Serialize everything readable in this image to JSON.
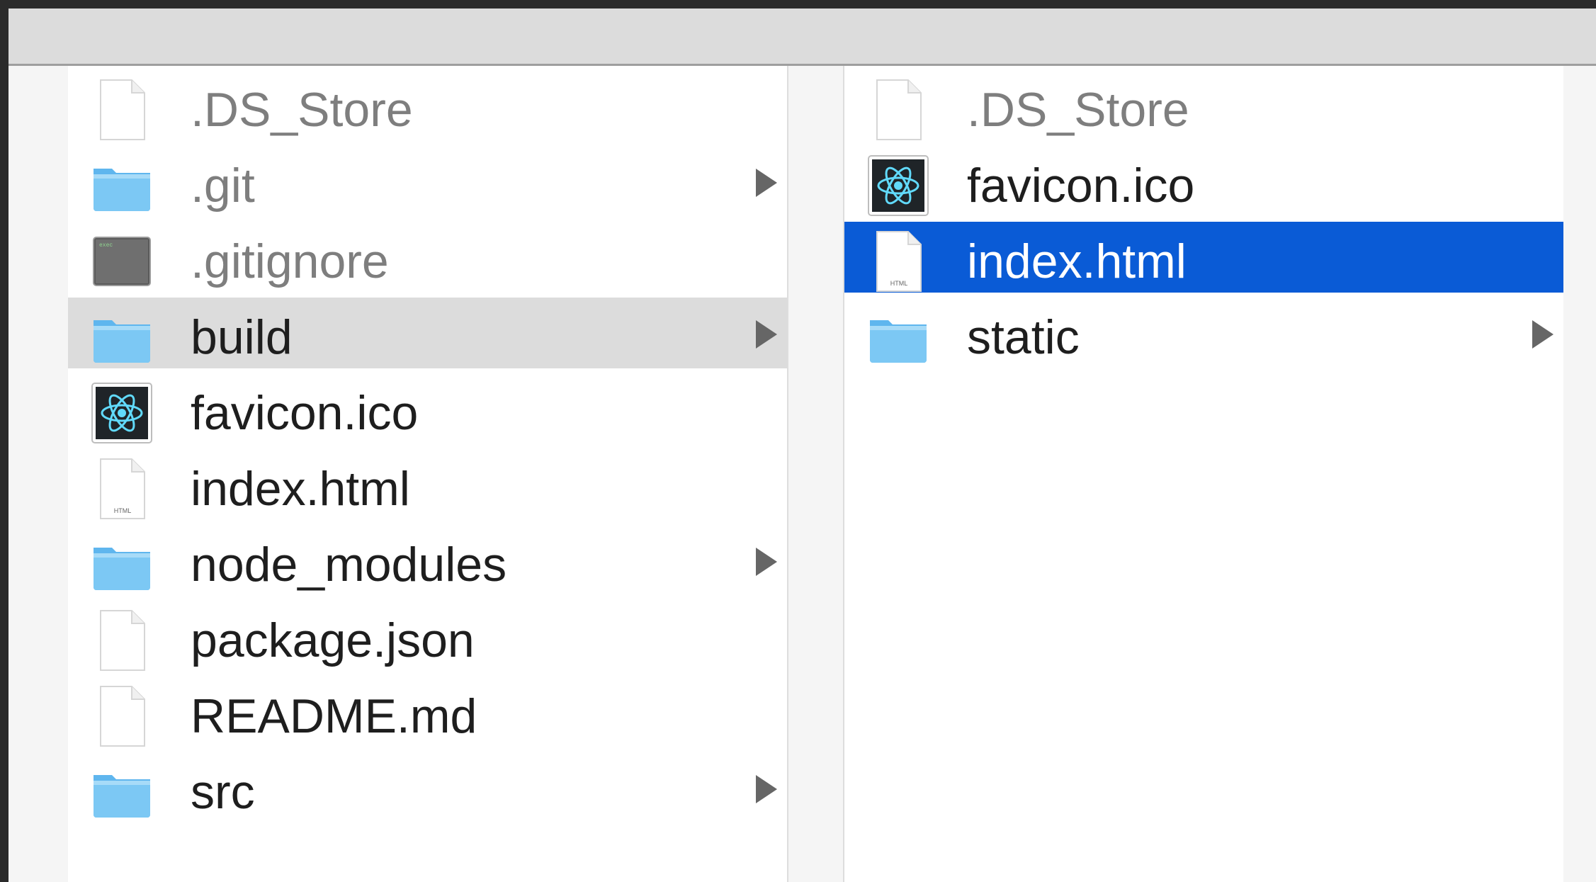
{
  "columns": [
    {
      "items": [
        {
          "name": ".DS_Store",
          "type": "file",
          "icon": "blank-file-icon",
          "dim": true
        },
        {
          "name": ".git",
          "type": "folder",
          "icon": "folder-icon",
          "dim": true
        },
        {
          "name": ".gitignore",
          "type": "file",
          "icon": "terminal-exec-icon",
          "dim": true,
          "icon_text": "exec"
        },
        {
          "name": "build",
          "type": "folder",
          "icon": "folder-icon",
          "state": "hover"
        },
        {
          "name": "favicon.ico",
          "type": "file",
          "icon": "react-icon"
        },
        {
          "name": "index.html",
          "type": "file",
          "icon": "html-file-icon",
          "icon_text": "HTML"
        },
        {
          "name": "node_modules",
          "type": "folder",
          "icon": "folder-icon"
        },
        {
          "name": "package.json",
          "type": "file",
          "icon": "blank-file-icon"
        },
        {
          "name": "README.md",
          "type": "file",
          "icon": "blank-file-icon"
        },
        {
          "name": "src",
          "type": "folder",
          "icon": "folder-icon"
        }
      ]
    },
    {
      "items": [
        {
          "name": ".DS_Store",
          "type": "file",
          "icon": "blank-file-icon",
          "dim": true
        },
        {
          "name": "favicon.ico",
          "type": "file",
          "icon": "react-icon"
        },
        {
          "name": "index.html",
          "type": "file",
          "icon": "html-file-icon",
          "icon_text": "HTML",
          "state": "selected"
        },
        {
          "name": "static",
          "type": "folder",
          "icon": "folder-icon"
        }
      ]
    }
  ],
  "colors": {
    "selection": "#0a5bd6",
    "hover": "#dcdcdc",
    "folder": "#7cc8f4",
    "react": "#61dafb"
  }
}
